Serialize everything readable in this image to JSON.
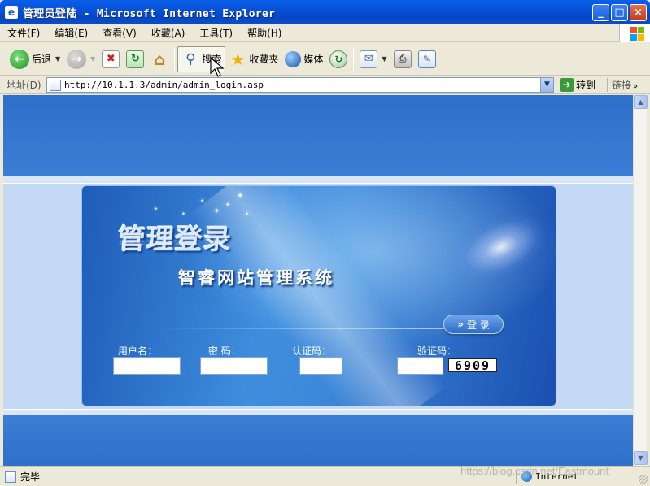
{
  "window": {
    "title": "管理员登陆 - Microsoft Internet Explorer",
    "min_label": "_",
    "max_label": "□",
    "close_label": "×"
  },
  "menu": {
    "items": [
      "文件(F)",
      "编辑(E)",
      "查看(V)",
      "收藏(A)",
      "工具(T)",
      "帮助(H)"
    ]
  },
  "toolbar": {
    "back_label": "后退",
    "search_label": "搜索",
    "favorites_label": "收藏夹",
    "media_label": "媒体"
  },
  "address": {
    "label": "地址(D)",
    "url": "http://10.1.1.3/admin/admin_login.asp",
    "go_label": "转到",
    "links_label": "链接"
  },
  "page": {
    "heading": "管理登录",
    "system_name": "智睿网站管理系统",
    "login_button": "登 录",
    "login_arrows": "»",
    "fields": {
      "username_label": "用户名：",
      "password_label": "密  码：",
      "auth_code_label": "认证码：",
      "verify_code_label": "验证码：",
      "username_value": "",
      "password_value": "",
      "auth_code_value": "",
      "verify_code_value": ""
    },
    "captcha_text": "6909"
  },
  "status": {
    "text": "完毕",
    "zone": "Internet",
    "watermark": "https://blog.csdn.net/Eastmount"
  },
  "colors": {
    "titlebar": "#0a54d6",
    "page_band": "#3271cd",
    "panel": "#3c87d9"
  }
}
